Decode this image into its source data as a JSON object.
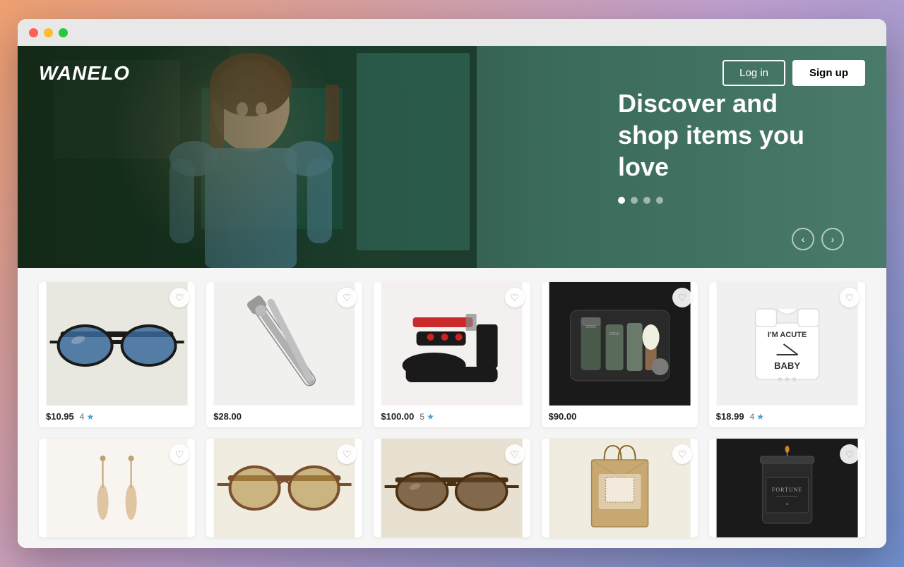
{
  "browser": {
    "traffic_lights": [
      "close",
      "minimize",
      "maximize"
    ]
  },
  "hero": {
    "logo": "WANELO",
    "login_label": "Log in",
    "signup_label": "Sign up",
    "title": "Discover and shop items you love",
    "dots": [
      {
        "active": true
      },
      {
        "active": false
      },
      {
        "active": false
      },
      {
        "active": false
      }
    ],
    "prev_arrow": "‹",
    "next_arrow": "›"
  },
  "products": {
    "row1": [
      {
        "price": "$10.95",
        "rating": "4",
        "has_star": true,
        "type": "sunglasses-blue"
      },
      {
        "price": "$28.00",
        "rating": null,
        "has_star": false,
        "type": "hair-clip"
      },
      {
        "price": "$100.00",
        "rating": "5",
        "has_star": true,
        "type": "platform-shoe"
      },
      {
        "price": "$90.00",
        "rating": null,
        "has_star": false,
        "type": "grooming-set"
      },
      {
        "price": "$18.99",
        "rating": "4",
        "has_star": true,
        "type": "baby-onesie"
      }
    ],
    "row2": [
      {
        "price": null,
        "rating": null,
        "type": "earrings"
      },
      {
        "price": null,
        "rating": null,
        "type": "tortoise-glasses"
      },
      {
        "price": null,
        "rating": null,
        "type": "brown-sunglasses"
      },
      {
        "price": null,
        "rating": null,
        "type": "gift-bag"
      },
      {
        "price": null,
        "rating": null,
        "type": "fortune-candle"
      }
    ]
  }
}
